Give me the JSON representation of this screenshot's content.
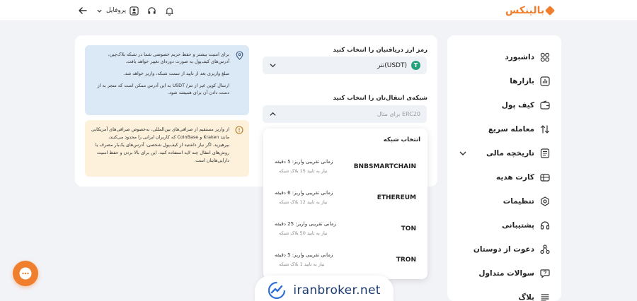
{
  "header": {
    "logo_text": "بالینکس",
    "profile_label": "پروفایل"
  },
  "sidebar": {
    "items": [
      {
        "label": "داشبورد",
        "icon": "dashboard-icon"
      },
      {
        "label": "بازارها",
        "icon": "markets-icon"
      },
      {
        "label": "کیف پول",
        "icon": "wallet-icon"
      },
      {
        "label": "معامله سریع",
        "icon": "swap-icon"
      },
      {
        "label": "تاریخچه مالی",
        "icon": "history-icon"
      },
      {
        "label": "کارت هدیه",
        "icon": "gift-icon"
      },
      {
        "label": "تنظیمات",
        "icon": "settings-icon"
      },
      {
        "label": "پشتیبانی",
        "icon": "headset-icon"
      },
      {
        "label": "دعوت از دوستان",
        "icon": "invite-icon"
      },
      {
        "label": "سوالات متداول",
        "icon": "faq-icon"
      },
      {
        "label": "بلاگ",
        "icon": "blog-icon"
      }
    ]
  },
  "form": {
    "currency_label": "رمز ارز دریافتیان را انتخاب کنید",
    "currency_value": "تتر(USDT)",
    "network_label": "شبکه‌ی انتقال‌تان را انتخاب کنید",
    "network_placeholder": "برای مثال ERC20"
  },
  "info_blue": {
    "p1": "برای امنیت بیشتر و حفظ حریم خصوصی شما در شبکه بلاک‌چین، آدرس‌های کیف‌پول به صورت دوره‌ای تغییر خواهد یافت.",
    "p2": "مبلغ واریزی بعد از تایید از سمت شبکه، واریز خواهد شد.",
    "p3": "ارسال کوین غیر از تتر/ USDT به این آدرس ممکن است که منجر به از دست دادن آن برای همیشه شود."
  },
  "info_yellow": {
    "text": "از واریز مستقیم از صرافی‌های بین‌المللی، به‌خصوص صرافی‌های آمریکایی مانند Kraken و CoinBase که کاربران ایرانی را محدود می‌کنند، بپرهیزید. اگر نیاز داشتید از کیف‌پول شخصی، آدرس‌های یک‌بار مصرف یا روش‌های انتقال چند لایه استفاده کنید. این برای بالا بردن و حفظ امنیت دارایی‌هایتان است."
  },
  "dropdown": {
    "title": "انتخاب شبکه",
    "networks": [
      {
        "name": "BNBSMARTCHAIN",
        "time": "زمانی تقریبی واریز: 5 دقیقه",
        "confirmations": "نیاز به تایید 15 بلاک شبکه"
      },
      {
        "name": "ETHEREUM",
        "time": "زمانی تقریبی واریز: 6 دقیقه",
        "confirmations": "نیاز به تایید 12 بلاک شبکه"
      },
      {
        "name": "TON",
        "time": "زمانی تقریبی واریز: 25 دقیقه",
        "confirmations": "نیاز به تایید 50 بلاک شبکه"
      },
      {
        "name": "TRON",
        "time": "زمانی تقریبی واریز: 5 دقیقه",
        "confirmations": "نیاز به تایید 1 بلاک شبکه"
      }
    ]
  },
  "watermark": {
    "text": "iranbroker.net"
  },
  "colors": {
    "brand": "#ef7e2d",
    "info_blue": "#dbe8f6",
    "info_yellow": "#fdf1dc",
    "tether": "#26a17b"
  }
}
